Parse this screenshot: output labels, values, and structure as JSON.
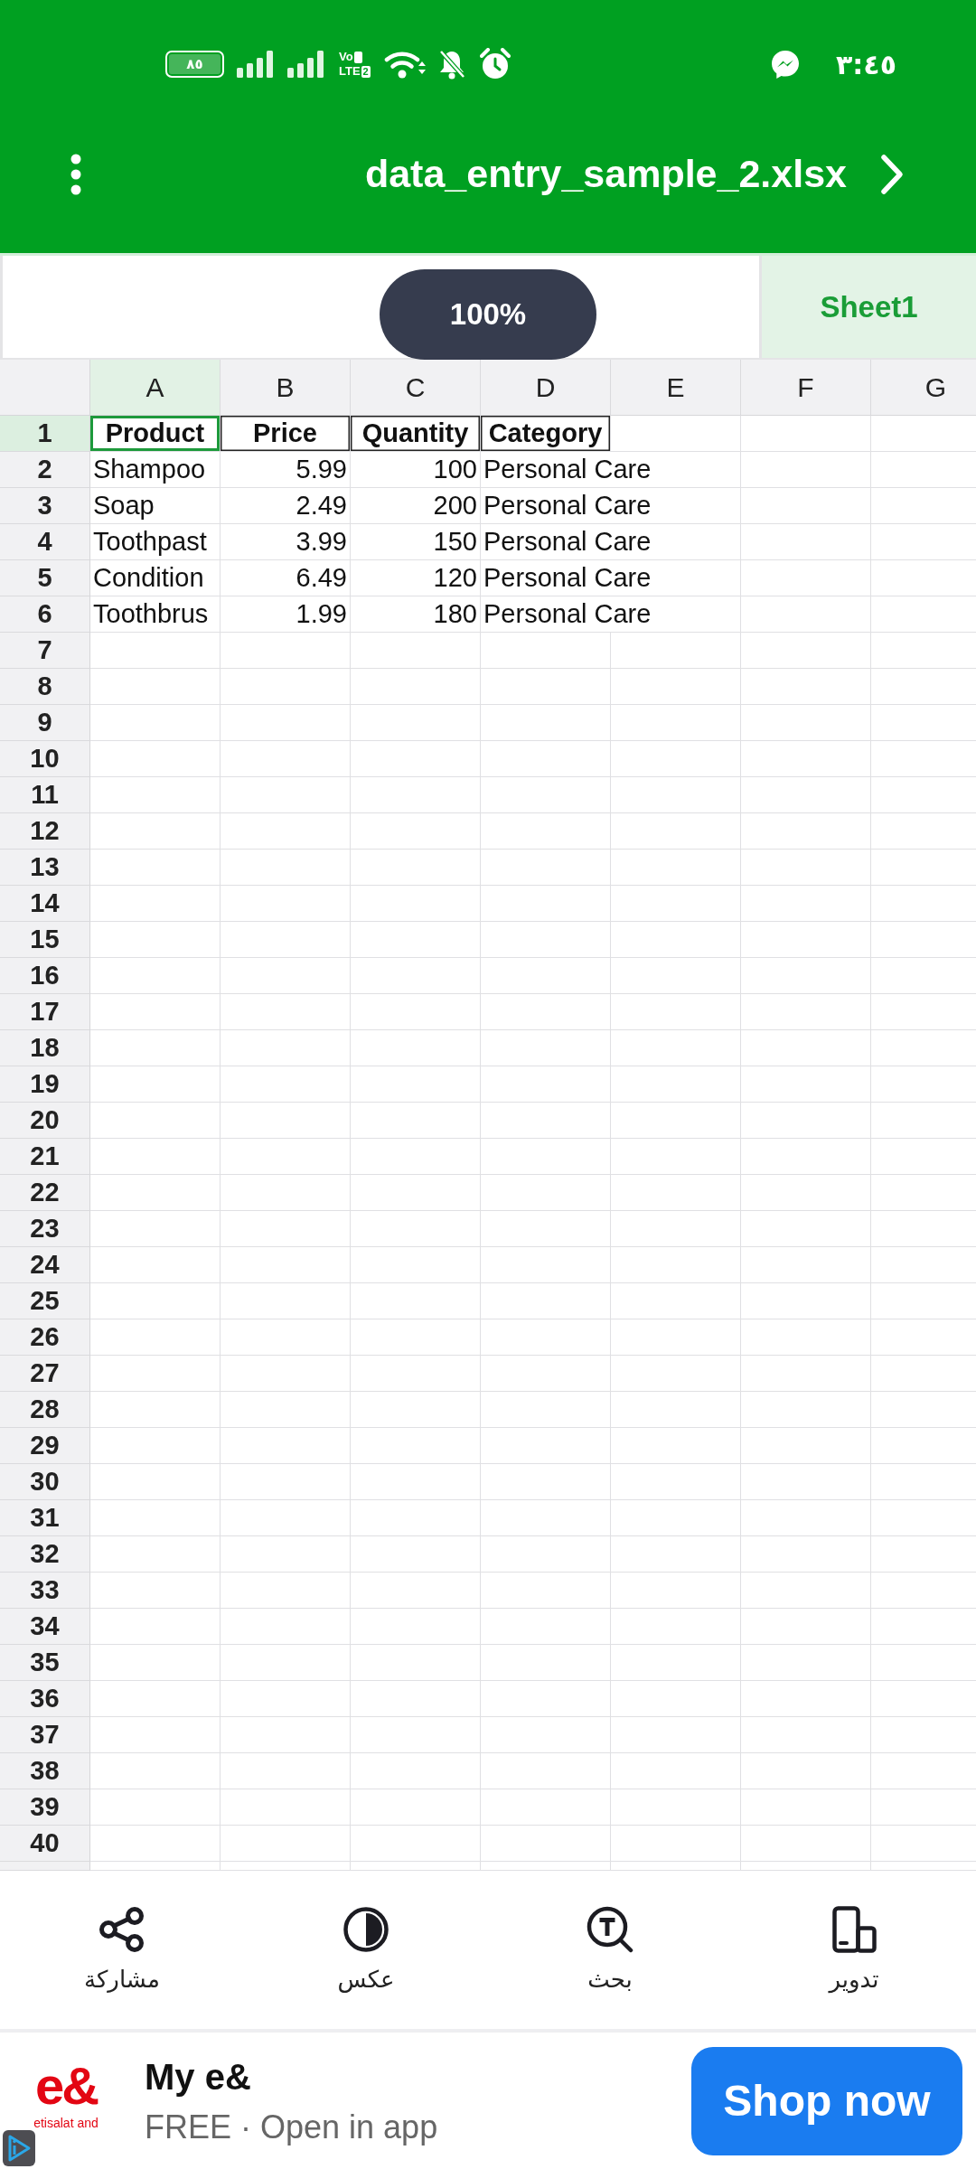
{
  "status_bar": {
    "battery": "٨٥",
    "volte": {
      "top": "Vo",
      "bottom": "LTE",
      "sim": "2"
    },
    "time": "٣:٤٥"
  },
  "title_bar": {
    "title": "data_entry_sample_2.xlsx"
  },
  "sheet_tabs": [
    {
      "label": "Sheet1",
      "selected": true
    }
  ],
  "zoom_indicator": {
    "text": "100%"
  },
  "grid": {
    "columns": [
      {
        "label": "A",
        "selected": true
      },
      {
        "label": "B",
        "selected": false
      },
      {
        "label": "C",
        "selected": false
      },
      {
        "label": "D",
        "selected": false
      },
      {
        "label": "E",
        "selected": false
      },
      {
        "label": "F",
        "selected": false
      },
      {
        "label": "G",
        "selected": false
      }
    ],
    "rows": [
      {
        "number": "1",
        "selected": true,
        "cells": [
          {
            "text": "Product",
            "kind": "header",
            "selected": true
          },
          {
            "text": "Price",
            "kind": "header",
            "selected": false
          },
          {
            "text": "Quantity",
            "kind": "header",
            "selected": false
          },
          {
            "text": "Category",
            "kind": "header",
            "selected": false
          }
        ]
      },
      {
        "number": "2",
        "selected": false,
        "cells": [
          {
            "text": "Shampoo",
            "kind": "text",
            "selected": false
          },
          {
            "text": "5.99",
            "kind": "number",
            "selected": false
          },
          {
            "text": "100",
            "kind": "number",
            "selected": false
          },
          {
            "text": "Personal Care",
            "kind": "text",
            "selected": false
          }
        ]
      },
      {
        "number": "3",
        "selected": false,
        "cells": [
          {
            "text": "Soap",
            "kind": "text",
            "selected": false
          },
          {
            "text": "2.49",
            "kind": "number",
            "selected": false
          },
          {
            "text": "200",
            "kind": "number",
            "selected": false
          },
          {
            "text": "Personal Care",
            "kind": "text",
            "selected": false
          }
        ]
      },
      {
        "number": "4",
        "selected": false,
        "cells": [
          {
            "text": "Toothpast",
            "kind": "text",
            "selected": false
          },
          {
            "text": "3.99",
            "kind": "number",
            "selected": false
          },
          {
            "text": "150",
            "kind": "number",
            "selected": false
          },
          {
            "text": "Personal Care",
            "kind": "text",
            "selected": false
          }
        ]
      },
      {
        "number": "5",
        "selected": false,
        "cells": [
          {
            "text": "Condition",
            "kind": "text",
            "selected": false
          },
          {
            "text": "6.49",
            "kind": "number",
            "selected": false
          },
          {
            "text": "120",
            "kind": "number",
            "selected": false
          },
          {
            "text": "Personal Care",
            "kind": "text",
            "selected": false
          }
        ]
      },
      {
        "number": "6",
        "selected": false,
        "cells": [
          {
            "text": "Toothbrus",
            "kind": "text",
            "selected": false
          },
          {
            "text": "1.99",
            "kind": "number",
            "selected": false
          },
          {
            "text": "180",
            "kind": "number",
            "selected": false
          },
          {
            "text": "Personal Care",
            "kind": "text",
            "selected": false
          }
        ]
      },
      {
        "number": "7",
        "selected": false
      },
      {
        "number": "8",
        "selected": false
      },
      {
        "number": "9",
        "selected": false
      },
      {
        "number": "10",
        "selected": false
      },
      {
        "number": "11",
        "selected": false
      },
      {
        "number": "12",
        "selected": false
      },
      {
        "number": "13",
        "selected": false
      },
      {
        "number": "14",
        "selected": false
      },
      {
        "number": "15",
        "selected": false
      },
      {
        "number": "16",
        "selected": false
      },
      {
        "number": "17",
        "selected": false
      },
      {
        "number": "18",
        "selected": false
      },
      {
        "number": "19",
        "selected": false
      },
      {
        "number": "20",
        "selected": false
      },
      {
        "number": "21",
        "selected": false
      },
      {
        "number": "22",
        "selected": false
      },
      {
        "number": "23",
        "selected": false
      },
      {
        "number": "24",
        "selected": false
      },
      {
        "number": "25",
        "selected": false
      },
      {
        "number": "26",
        "selected": false
      },
      {
        "number": "27",
        "selected": false
      },
      {
        "number": "28",
        "selected": false
      },
      {
        "number": "29",
        "selected": false
      },
      {
        "number": "30",
        "selected": false
      },
      {
        "number": "31",
        "selected": false
      },
      {
        "number": "32",
        "selected": false
      },
      {
        "number": "33",
        "selected": false
      },
      {
        "number": "34",
        "selected": false
      },
      {
        "number": "35",
        "selected": false
      },
      {
        "number": "36",
        "selected": false
      },
      {
        "number": "37",
        "selected": false
      },
      {
        "number": "38",
        "selected": false
      },
      {
        "number": "39",
        "selected": false
      },
      {
        "number": "40",
        "selected": false
      }
    ]
  },
  "toolbar": [
    {
      "label": "تدوير"
    },
    {
      "label": "بحث"
    },
    {
      "label": "عكس"
    },
    {
      "label": "مشاركة"
    }
  ],
  "ad": {
    "logo": "e&",
    "brand": "etisalat and",
    "title": "My e&",
    "subtitle": "FREE · Open in app",
    "button": "Shop now"
  }
}
